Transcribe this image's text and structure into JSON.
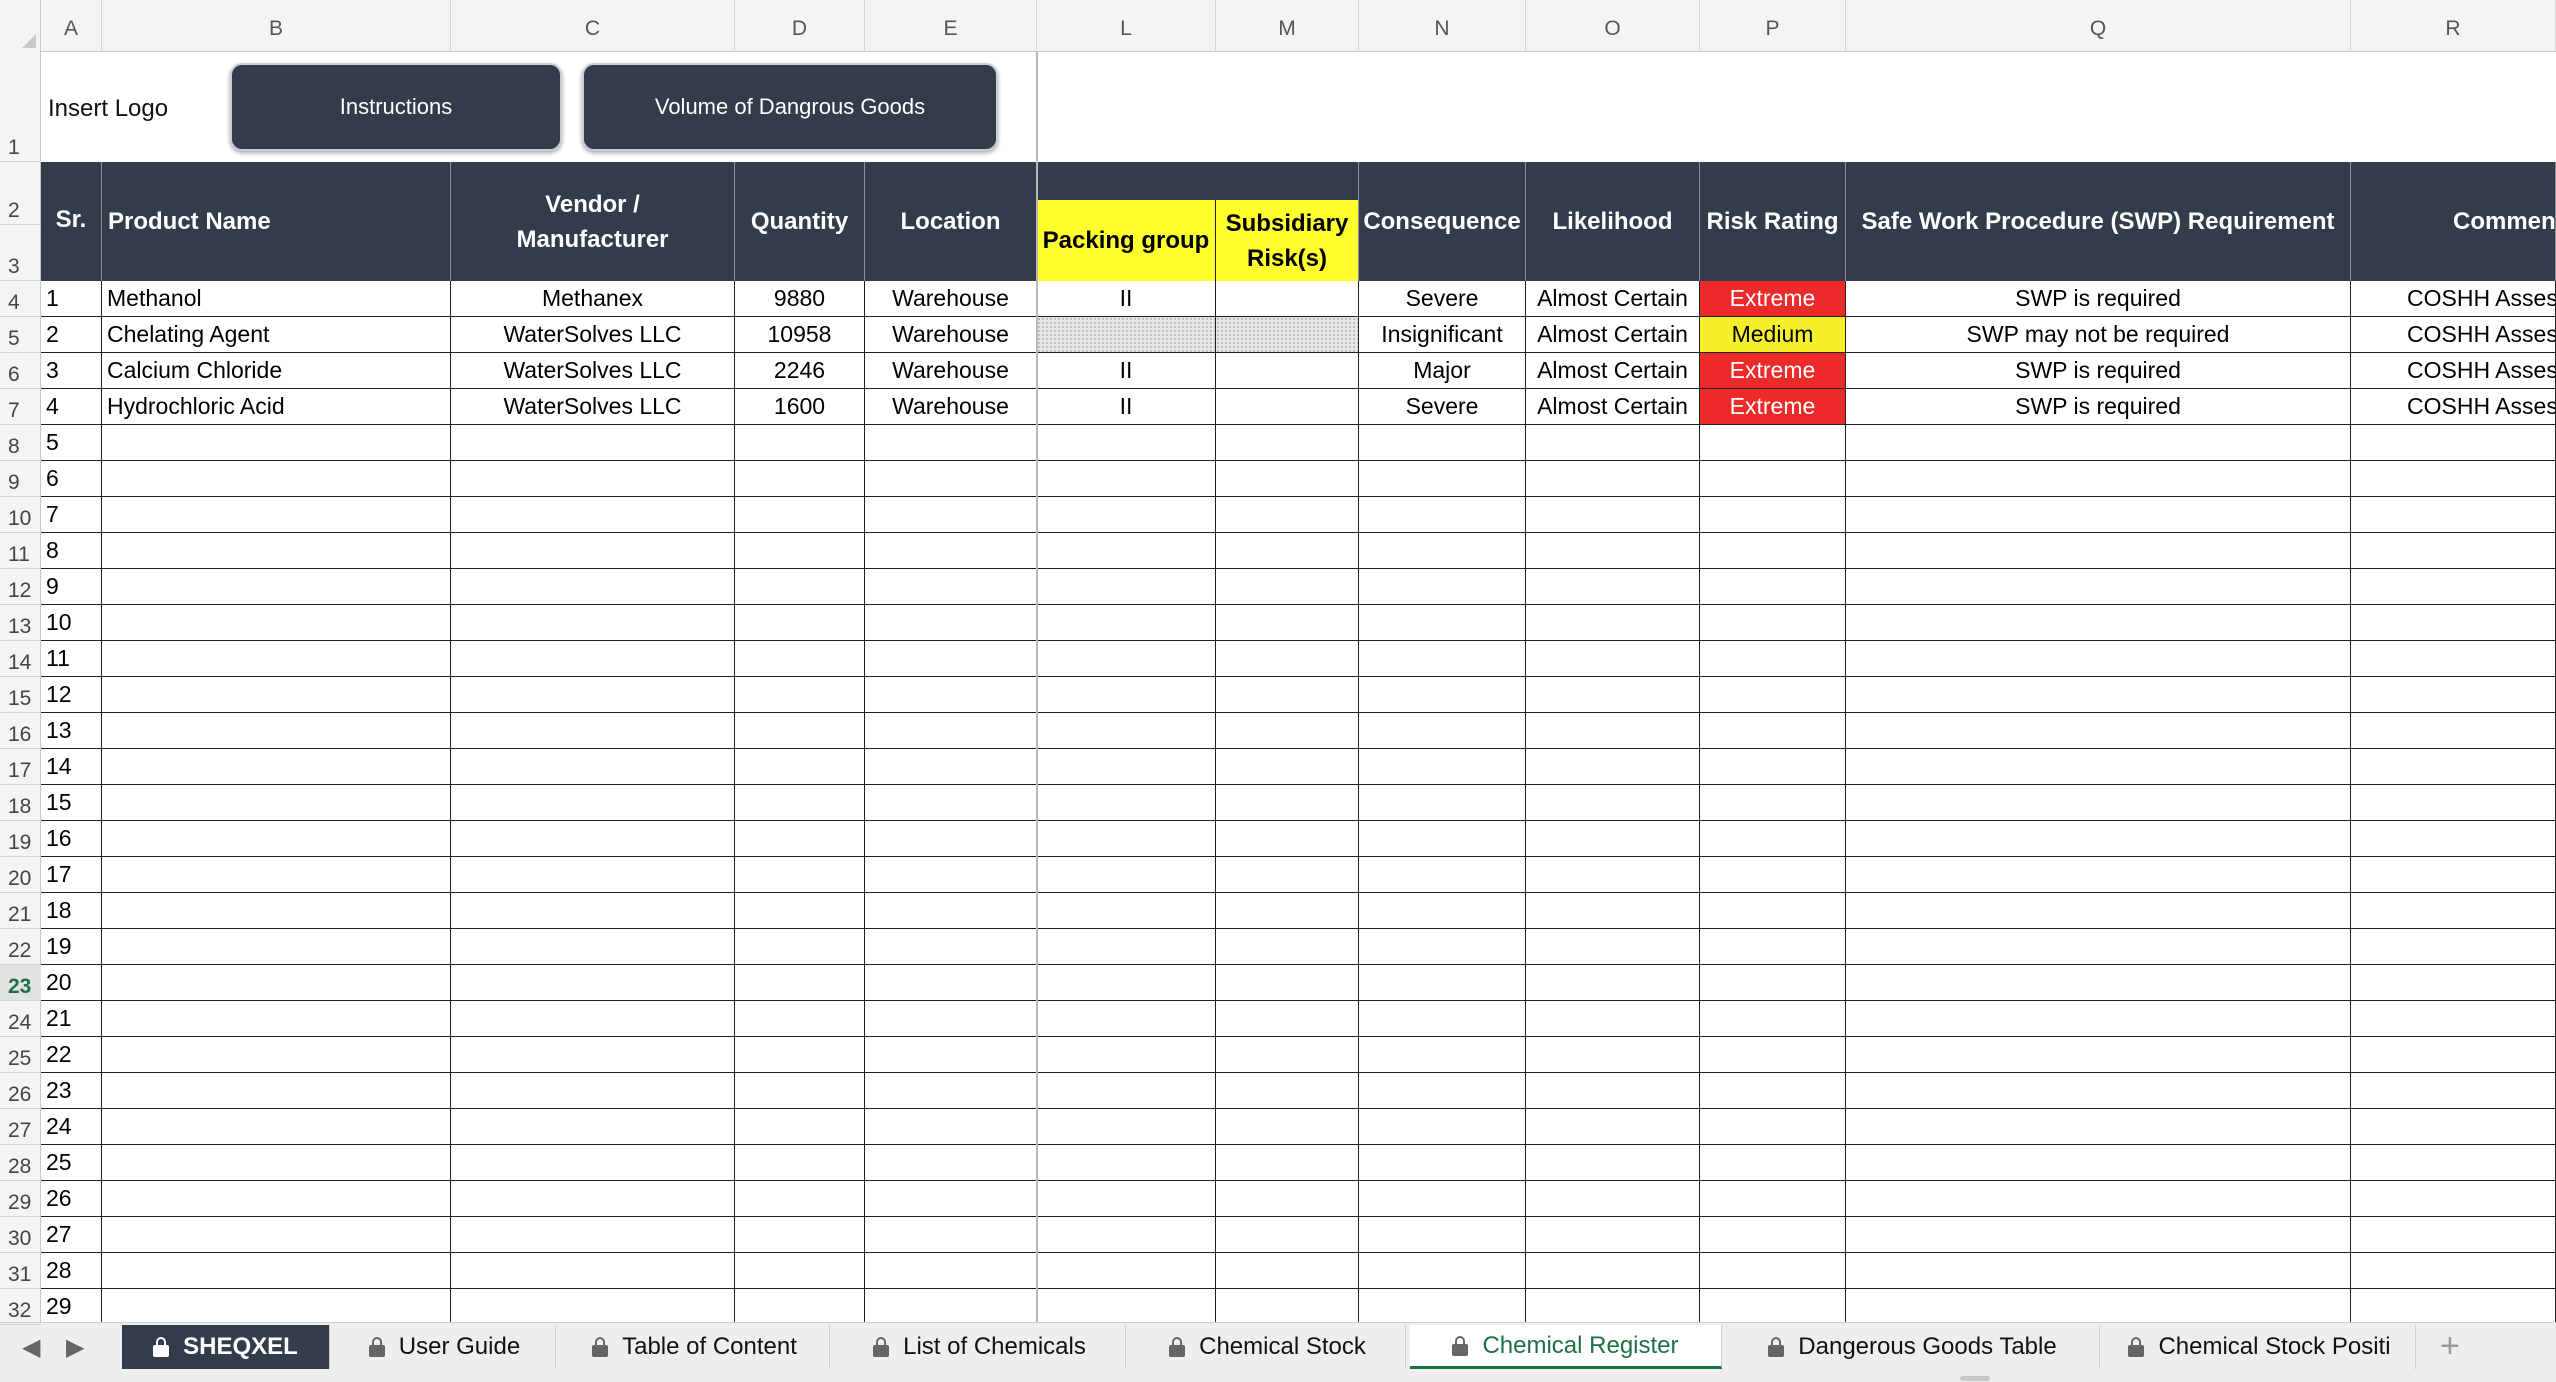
{
  "column_letters": [
    "A",
    "B",
    "C",
    "D",
    "E",
    "L",
    "M",
    "N",
    "O",
    "P",
    "Q",
    "R"
  ],
  "row_numbers": [
    "1",
    "2",
    "3",
    "4",
    "5",
    "6",
    "7",
    "8",
    "9",
    "10",
    "11",
    "12",
    "13",
    "14",
    "15",
    "16",
    "17",
    "18",
    "19",
    "20",
    "21",
    "22",
    "23",
    "24",
    "25",
    "26",
    "27",
    "28",
    "29",
    "30",
    "31",
    "32"
  ],
  "active_row": "23",
  "top": {
    "logo_text": "Insert Logo",
    "instructions_button": "Instructions",
    "volume_button": "Volume of Dangrous Goods"
  },
  "headers": {
    "sr": "Sr.",
    "product_name": "Product Name",
    "vendor": "Vendor / Manufacturer",
    "quantity": "Quantity",
    "location": "Location",
    "packing_group": "Packing group",
    "subsidiary_risk": "Subsidiary Risk(s)",
    "consequence": "Consequence",
    "likelihood": "Likelihood",
    "risk_rating": "Risk Rating",
    "swp": "Safe Work Procedure (SWP) Requirement",
    "comments": "Commen"
  },
  "rows": [
    {
      "sr": "1",
      "product": "Methanol",
      "vendor": "Methanex",
      "quantity": "9880",
      "location": "Warehouse",
      "packing": "II",
      "subsidiary": "",
      "consequence": "Severe",
      "likelihood": "Almost Certain",
      "risk": "Extreme",
      "swp": "SWP is required",
      "comments": "COSHH Assessm"
    },
    {
      "sr": "2",
      "product": "Chelating Agent",
      "vendor": "WaterSolves LLC",
      "quantity": "10958",
      "location": "Warehouse",
      "packing": "",
      "subsidiary": "",
      "consequence": "Insignificant",
      "likelihood": "Almost Certain",
      "risk": "Medium",
      "swp": "SWP may not be required",
      "comments": "COSHH Assessm"
    },
    {
      "sr": "3",
      "product": "Calcium Chloride",
      "vendor": "WaterSolves LLC",
      "quantity": "2246",
      "location": "Warehouse",
      "packing": "II",
      "subsidiary": "",
      "consequence": "Major",
      "likelihood": "Almost Certain",
      "risk": "Extreme",
      "swp": "SWP is required",
      "comments": "COSHH Assessm"
    },
    {
      "sr": "4",
      "product": "Hydrochloric Acid",
      "vendor": "WaterSolves LLC",
      "quantity": "1600",
      "location": "Warehouse",
      "packing": "II",
      "subsidiary": "",
      "consequence": "Severe",
      "likelihood": "Almost Certain",
      "risk": "Extreme",
      "swp": "SWP is required",
      "comments": "COSHH Assessm"
    }
  ],
  "empty_sr": [
    "5",
    "6",
    "7",
    "8",
    "9",
    "10",
    "11",
    "12",
    "13",
    "14",
    "15",
    "16",
    "17",
    "18",
    "19",
    "20",
    "21",
    "22",
    "23",
    "24",
    "25",
    "26",
    "27",
    "28",
    "29"
  ],
  "colors": {
    "header_bg": "#323c4a",
    "yellow_header": "#ffff2e",
    "extreme": "#ec2a2a",
    "medium": "#f6f02c",
    "active_tab": "#1e7145"
  },
  "tabs": [
    {
      "label": "SHEQXEL",
      "icon": "lock-icon"
    },
    {
      "label": "User Guide",
      "icon": "lock-icon"
    },
    {
      "label": "Table of Content",
      "icon": "lock-icon"
    },
    {
      "label": "List of Chemicals",
      "icon": "lock-icon"
    },
    {
      "label": "Chemical Stock",
      "icon": "lock-icon"
    },
    {
      "label": "Chemical Register",
      "icon": "lock-icon"
    },
    {
      "label": "Dangerous Goods Table",
      "icon": "lock-icon"
    },
    {
      "label": "Chemical Stock Positi",
      "icon": "lock-icon"
    }
  ],
  "active_tab": "Chemical Register",
  "add_sheet": "+"
}
